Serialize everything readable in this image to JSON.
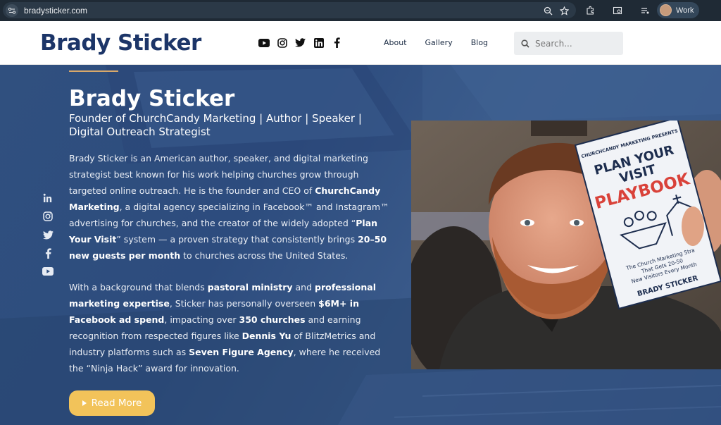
{
  "browser": {
    "url": "bradysticker.com",
    "profile_label": "Work"
  },
  "header": {
    "logo": "Brady Sticker",
    "social_icons": [
      "youtube-icon",
      "instagram-icon",
      "twitter-icon",
      "linkedin-icon",
      "facebook-icon"
    ],
    "nav": [
      {
        "label": "About"
      },
      {
        "label": "Gallery"
      },
      {
        "label": "Blog"
      }
    ],
    "search_placeholder": "Search..."
  },
  "hero": {
    "title": "Brady Sticker",
    "subtitle_line1": "Founder of ChurchCandy Marketing | Author | Speaker |",
    "subtitle_line2": "Digital Outreach Strategist",
    "bio1": {
      "t1": "Brady Sticker is an American author, speaker, and digital marketing strategist best known for his work helping churches grow through targeted online outreach. He is the founder and CEO of ",
      "b1": "ChurchCandy Marketing",
      "t2": ", a digital agency specializing in Facebook™ and Instagram™ advertising for churches, and the creator of the widely adopted “",
      "b2": "Plan Your Visit",
      "t3": "” system — a proven strategy that consistently brings ",
      "b3": "20–50 new guests per month",
      "t4": " to churches across the United States."
    },
    "bio2": {
      "t1": "With a background that blends ",
      "b1": "pastoral ministry",
      "t2": " and ",
      "b2": "professional marketing expertise",
      "t3": ", Sticker has personally overseen ",
      "b3": "$6M+ in Facebook ad spend",
      "t4": ", impacting over ",
      "b4": "350 churches",
      "t5": " and earning recognition from respected figures like ",
      "b5": "Dennis Yu",
      "t6": " of BlitzMetrics and industry platforms such as ",
      "b6": "Seven Figure Agency",
      "t7": ", where he received the “Ninja Hack” award for innovation."
    },
    "side_social_icons": [
      "linkedin-icon",
      "instagram-icon",
      "twitter-icon",
      "facebook-icon",
      "youtube-icon"
    ],
    "read_more_label": "Read More"
  },
  "book": {
    "presents": "CHURCHCANDY MARKETING PRESENTS",
    "title1": "PLAN YOUR",
    "title2": "VISIT",
    "title3": "PLAYBOOK",
    "tagline1": "The Church Marketing Stra",
    "tagline2": "That Gets 20-50",
    "tagline3": "New Visitors Every Month",
    "author": "BRADY STICKER"
  },
  "colors": {
    "brand_navy": "#1c3568",
    "hero_blue": "#30507f",
    "accent_gold": "#f2c35a",
    "book_red": "#d9423a"
  }
}
